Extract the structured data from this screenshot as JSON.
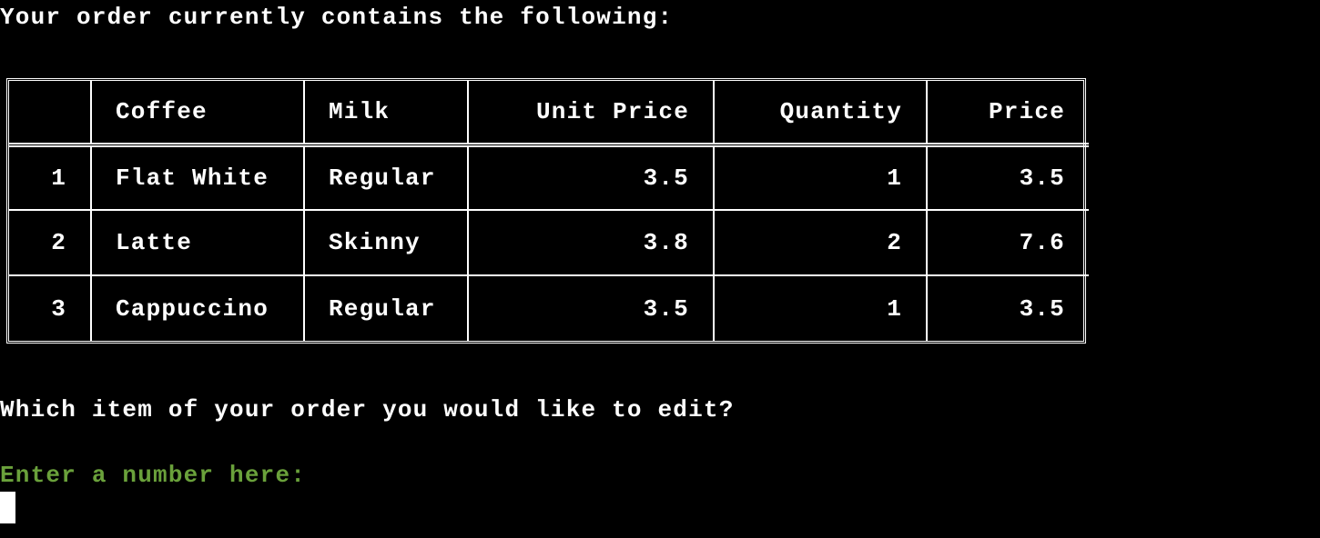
{
  "colors": {
    "background": "#000000",
    "text": "#ffffff",
    "prompt": "#6aa13b"
  },
  "terminal": {
    "intro": "Your order currently contains the following:",
    "question": "Which item of your order you would like to edit?",
    "prompt": "Enter a number here:"
  },
  "table": {
    "headers": [
      "",
      "Coffee",
      "Milk",
      "Unit Price",
      "Quantity",
      "Price"
    ],
    "rows": [
      [
        "1",
        "Flat White",
        "Regular",
        "3.5",
        "1",
        "3.5"
      ],
      [
        "2",
        "Latte",
        "Skinny",
        "3.8",
        "2",
        "7.6"
      ],
      [
        "3",
        "Cappuccino",
        "Regular",
        "3.5",
        "1",
        "3.5"
      ]
    ]
  }
}
